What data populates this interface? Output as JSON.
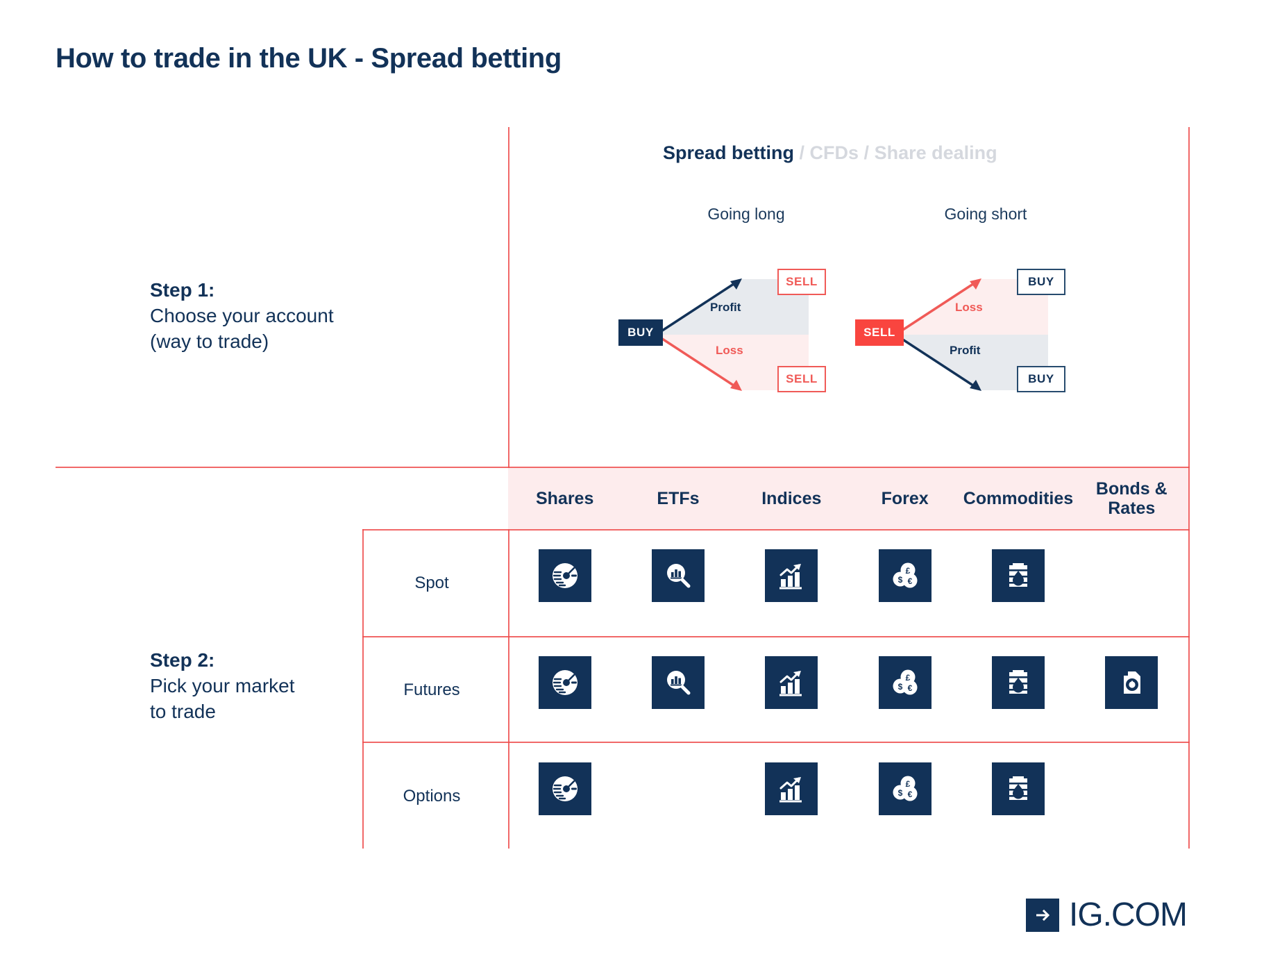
{
  "title": "How to trade in the UK - Spread betting",
  "account_tabs": {
    "active": "Spread betting",
    "sep1": " / ",
    "inactive1": "CFDs",
    "sep2": " / ",
    "inactive2": "Share dealing"
  },
  "steps": [
    {
      "heading": "Step 1:",
      "line1": "Choose your account",
      "line2": "(way to trade)"
    },
    {
      "heading": "Step 2:",
      "line1": "Pick your market",
      "line2": "to trade"
    }
  ],
  "diagrams": [
    {
      "title": "Going long",
      "origin_label": "BUY",
      "upper_outcome": "SELL",
      "lower_outcome": "SELL",
      "upper_zone": "Profit",
      "lower_zone": "Loss"
    },
    {
      "title": "Going short",
      "origin_label": "SELL",
      "upper_outcome": "BUY",
      "lower_outcome": "BUY",
      "upper_zone": "Loss",
      "lower_zone": "Profit"
    }
  ],
  "matrix": {
    "columns": [
      "Shares",
      "ETFs",
      "Indices",
      "Forex",
      "Commodities",
      "Bonds & Rates"
    ],
    "rows": [
      {
        "label": "Spot",
        "icons": [
          "shares",
          "etfs",
          "indices",
          "forex",
          "commodities",
          null
        ]
      },
      {
        "label": "Futures",
        "icons": [
          "shares",
          "etfs",
          "indices",
          "forex",
          "commodities",
          "bonds"
        ]
      },
      {
        "label": "Options",
        "icons": [
          "shares",
          null,
          "indices",
          "forex",
          "commodities",
          null
        ]
      }
    ]
  },
  "logo": {
    "icon": "arrow-right-icon",
    "text": "IG.COM"
  },
  "colors": {
    "navy": "#123258",
    "coral": "#ef4d4d",
    "red": "#f9453f",
    "pink_fill": "#fdeced",
    "grey_fill": "#e7eaee",
    "muted": "#d5d8de"
  }
}
